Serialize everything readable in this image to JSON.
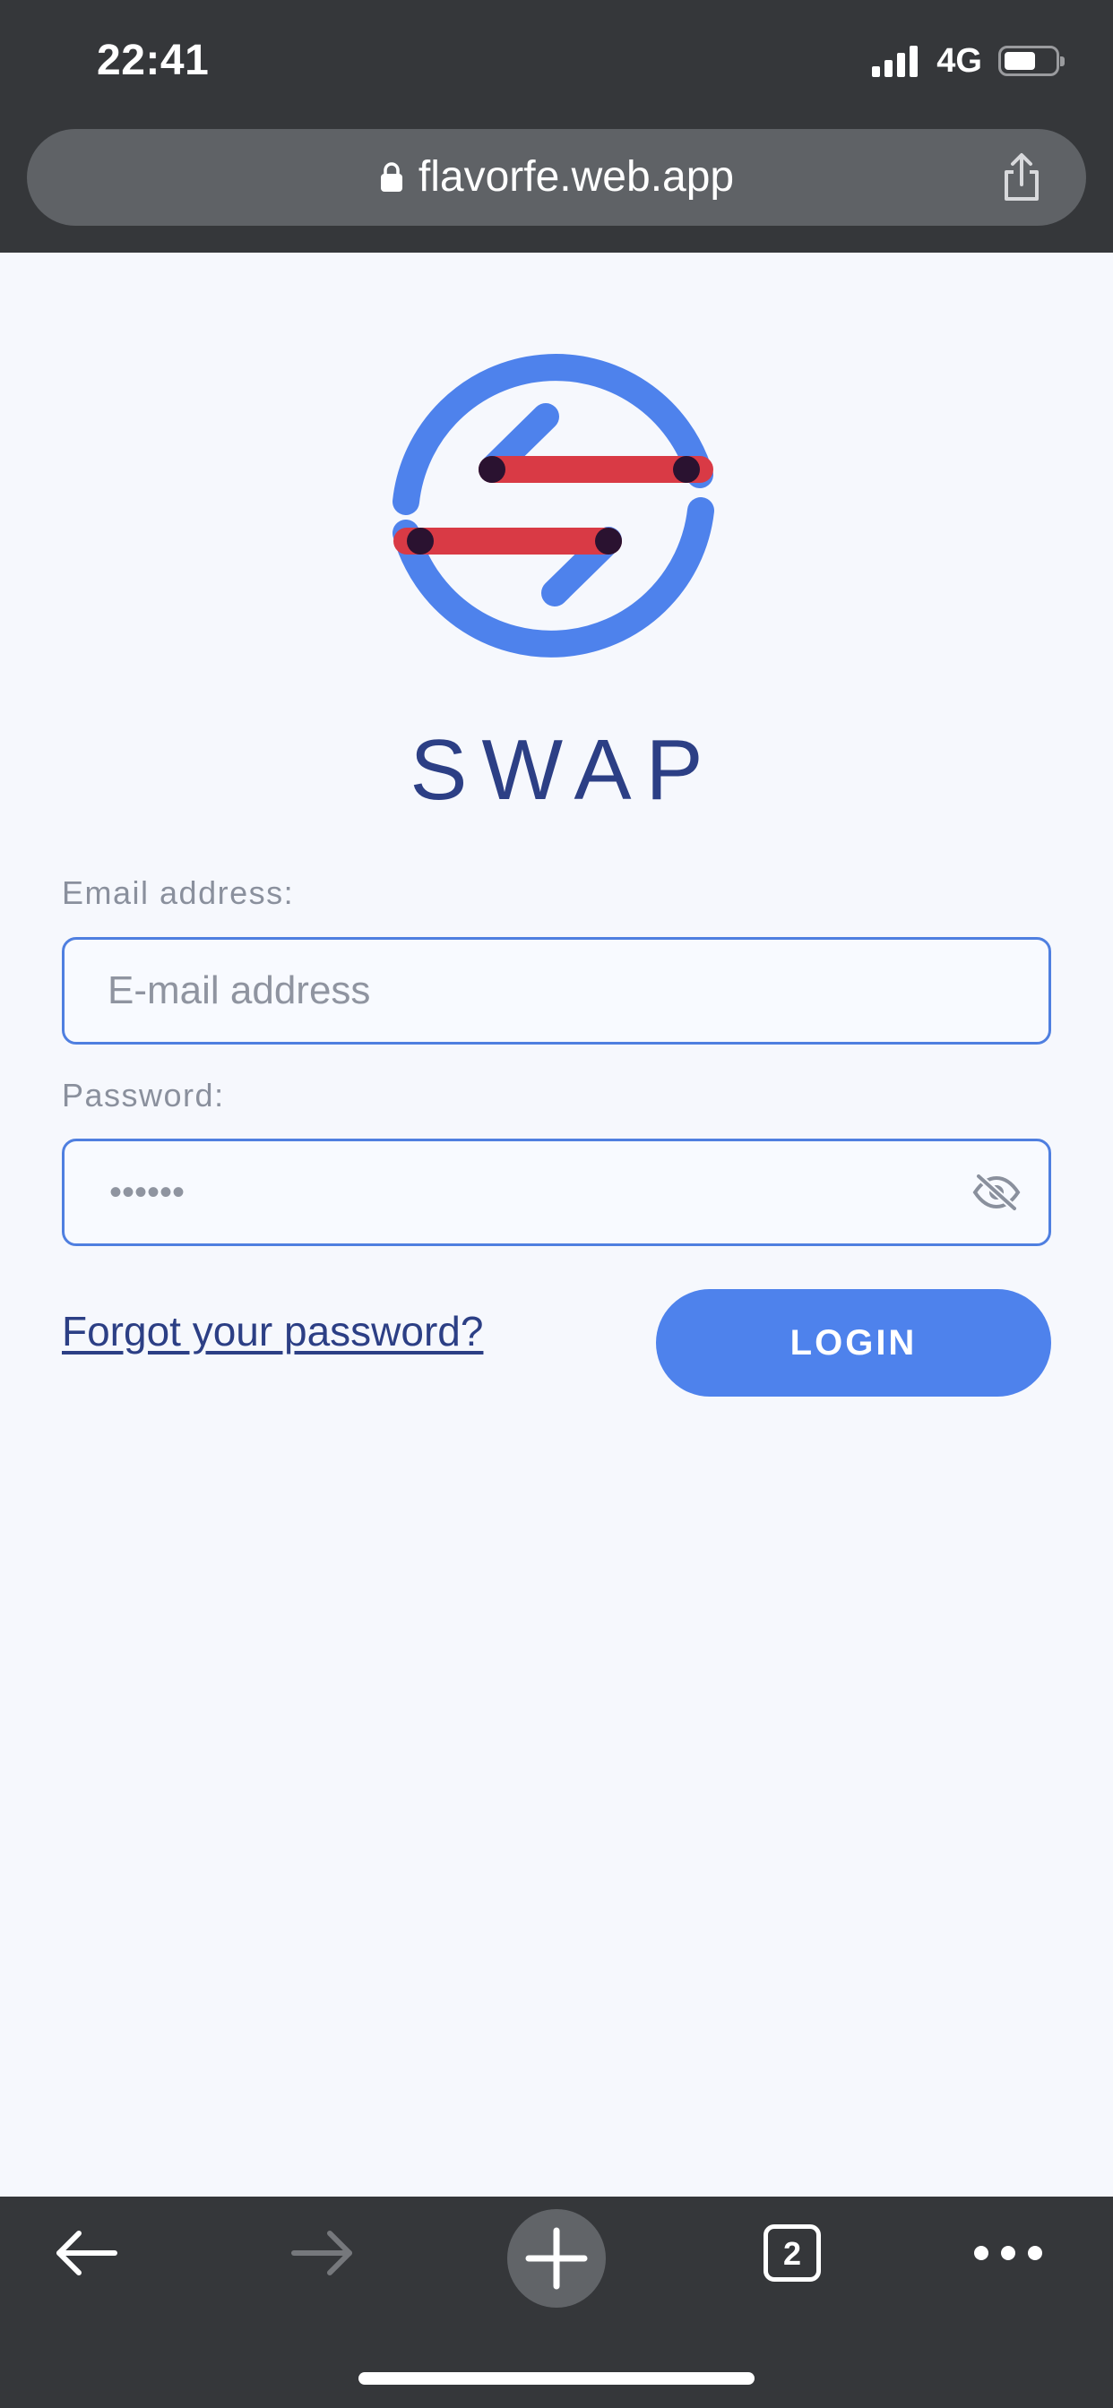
{
  "status_bar": {
    "time": "22:41",
    "network": "4G"
  },
  "browser": {
    "url": "flavorfe.web.app",
    "tab_count": "2"
  },
  "brand": {
    "title": "SWAP",
    "colors": {
      "ring": "#4e82ec",
      "bar": "#d93a45",
      "overlap": "#2a1230"
    }
  },
  "form": {
    "email_label": "Email address:",
    "email_placeholder": "E-mail address",
    "email_value": "",
    "password_label": "Password:",
    "password_value": "••••••",
    "forgot_link": "Forgot your password?",
    "login_button": "LOGIN"
  },
  "colors": {
    "accent": "#4e82ec",
    "title": "#2c3f85",
    "background": "#f6f8fd",
    "chrome": "#35373a"
  },
  "icons": {
    "lock": "lock-icon",
    "share": "share-icon",
    "eye": "eye-slash-icon",
    "back": "arrow-left-icon",
    "forward": "arrow-right-icon",
    "new_tab": "plus-icon",
    "more": "more-horizontal-icon"
  }
}
